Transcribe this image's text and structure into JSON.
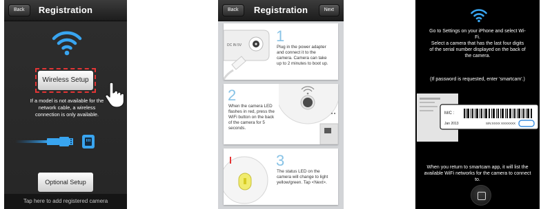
{
  "screen1": {
    "nav": {
      "back": "Back",
      "title": "Registration"
    },
    "wireless_button": "Wireless Setup",
    "info_line1": "If a model is not available for the",
    "info_line2": "network cable, a wireless",
    "info_line3": "connection is only available.",
    "optional_button": "Optional Setup",
    "bottom": "Tap here to add registered camera"
  },
  "screen2": {
    "nav": {
      "back": "Back",
      "title": "Registration",
      "next": "Next"
    },
    "power_label": "DC IN 5V",
    "steps": [
      {
        "num": "1",
        "lines": [
          "Plug in the power adapter",
          "and connect  it to the",
          "camera. Camera can take",
          "up to 2 minutes to boot up."
        ]
      },
      {
        "num": "2",
        "lines": [
          "When the camera LED",
          "flashes in red, press the",
          "WiFi button on the back",
          "of the camera for 5",
          "seconds."
        ]
      },
      {
        "num": "3",
        "lines": [
          "The status LED on the",
          "camera will change to light",
          "yellow/green. Tap <Next>."
        ]
      }
    ]
  },
  "screen3": {
    "text1_line1": "Go to Settings on your iPhone and select Wi-",
    "text1_line2": "Fi.",
    "text2_line1": "Select a camera that has the last four digits",
    "text2_line2": "of the serial number displayed on the back of",
    "text2_line3": "the camera.",
    "password": "(If password is requested, enter 'smartcam'.)",
    "label": {
      "mc": "M/C :",
      "date": "Jan 2013",
      "sn": "S/N:XXXX XXXXXXX",
      "sn_highlight": "XXXX"
    },
    "text3_line1": "When you return to smartcam app, it will list the",
    "text3_line2": "available WiFi networks for the camera to connect",
    "text3_line3": "to."
  },
  "colors": {
    "wifi_blue": "#39a5f0",
    "highlight_red": "#e53535",
    "step_blue": "#88c3e6",
    "screen1_bg": "#2a2a2a",
    "screen3_bg": "#000000"
  },
  "icons": [
    "wifi-icon",
    "hand-pointer-icon",
    "ethernet-cable-icon",
    "home-button-icon"
  ]
}
